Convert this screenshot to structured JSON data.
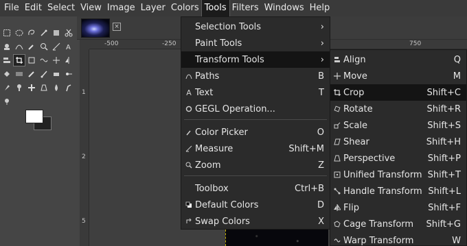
{
  "menubar": {
    "items": [
      "File",
      "Edit",
      "Select",
      "View",
      "Image",
      "Layer",
      "Colors",
      "Tools",
      "Filters",
      "Windows",
      "Help"
    ],
    "active_index": 7
  },
  "rulers": {
    "horizontal_labels": [
      "-500",
      "-250",
      "750"
    ],
    "vertical_labels": [
      "1",
      "2",
      "5"
    ]
  },
  "tools_menu": {
    "items": [
      {
        "label": "Selection Tools",
        "shortcut": "",
        "icon": "",
        "submenu": true
      },
      {
        "label": "Paint Tools",
        "shortcut": "",
        "icon": "",
        "submenu": true
      },
      {
        "label": "Transform Tools",
        "shortcut": "",
        "icon": "",
        "submenu": true,
        "highlighted": true
      },
      {
        "label": "Paths",
        "shortcut": "B",
        "icon": "paths-icon"
      },
      {
        "label": "Text",
        "shortcut": "T",
        "icon": "text-icon"
      },
      {
        "label": "GEGL Operation...",
        "shortcut": "",
        "icon": "gegl-icon"
      },
      {
        "label": "Color Picker",
        "shortcut": "O",
        "icon": "color-picker-icon"
      },
      {
        "label": "Measure",
        "shortcut": "Shift+M",
        "icon": "measure-icon"
      },
      {
        "label": "Zoom",
        "shortcut": "Z",
        "icon": "zoom-icon"
      },
      {
        "label": "Toolbox",
        "shortcut": "Ctrl+B",
        "icon": ""
      },
      {
        "label": "Default Colors",
        "shortcut": "D",
        "icon": "default-colors-icon"
      },
      {
        "label": "Swap Colors",
        "shortcut": "X",
        "icon": "swap-colors-icon"
      }
    ]
  },
  "transform_menu": {
    "items": [
      {
        "label": "Align",
        "shortcut": "Q",
        "icon": "align-icon"
      },
      {
        "label": "Move",
        "shortcut": "M",
        "icon": "move-icon"
      },
      {
        "label": "Crop",
        "shortcut": "Shift+C",
        "icon": "crop-icon",
        "highlighted": true
      },
      {
        "label": "Rotate",
        "shortcut": "Shift+R",
        "icon": "rotate-icon"
      },
      {
        "label": "Scale",
        "shortcut": "Shift+S",
        "icon": "scale-icon"
      },
      {
        "label": "Shear",
        "shortcut": "Shift+H",
        "icon": "shear-icon"
      },
      {
        "label": "Perspective",
        "shortcut": "Shift+P",
        "icon": "perspective-icon"
      },
      {
        "label": "Unified Transform",
        "shortcut": "Shift+T",
        "icon": "unified-transform-icon"
      },
      {
        "label": "Handle Transform",
        "shortcut": "Shift+L",
        "icon": "handle-transform-icon"
      },
      {
        "label": "Flip",
        "shortcut": "Shift+F",
        "icon": "flip-icon"
      },
      {
        "label": "Cage Transform",
        "shortcut": "Shift+G",
        "icon": "cage-transform-icon"
      },
      {
        "label": "Warp Transform",
        "shortcut": "W",
        "icon": "warp-transform-icon"
      }
    ]
  },
  "colors": {
    "foreground": "#ffffff",
    "background": "#222222",
    "menu_bg": "#2b2b2b",
    "highlight_bg": "#141414"
  }
}
